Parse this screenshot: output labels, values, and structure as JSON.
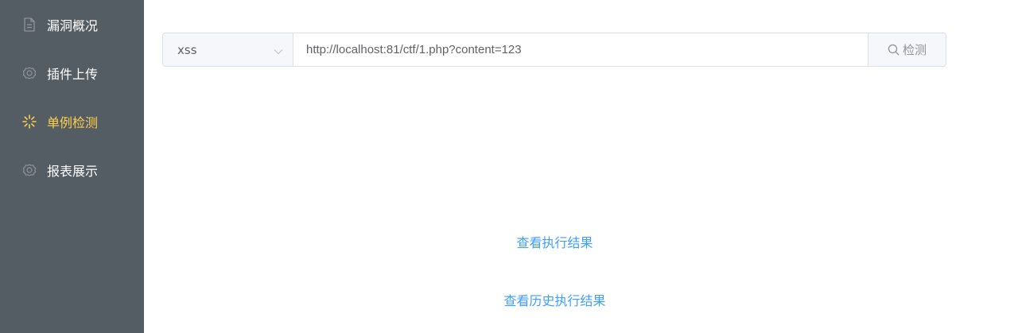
{
  "sidebar": {
    "background": "#545c64",
    "active_color": "#ffd04b",
    "items": [
      {
        "label": "漏洞概况",
        "icon": "document-icon"
      },
      {
        "label": "插件上传",
        "icon": "gear-icon"
      },
      {
        "label": "单例检测",
        "icon": "loading-icon",
        "active": true
      },
      {
        "label": "报表展示",
        "icon": "gear-icon"
      }
    ]
  },
  "search": {
    "type_selected": "xss",
    "url_value": "http://localhost:81/ctf/1.php?content=123",
    "button_label": "检测"
  },
  "links": {
    "view_result": "查看执行结果",
    "view_history": "查看历史执行结果"
  },
  "colors": {
    "link": "#409eff"
  }
}
